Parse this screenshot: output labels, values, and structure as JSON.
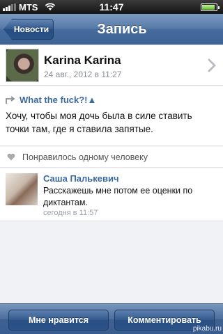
{
  "status_bar": {
    "carrier": "MTS",
    "time": "11:47"
  },
  "nav": {
    "back_label": "Новости",
    "title": "Запись"
  },
  "author": {
    "name": "Karina Karina",
    "date": "24 авг., 2012 в 11:27"
  },
  "post": {
    "repost_title": "What the fuck?!▲",
    "text": "Хочу, чтобы моя дочь была в силе ставить точки там, где я ставила запятые."
  },
  "likes": {
    "text": "Понравилось одному человеку"
  },
  "comment": {
    "author": "Саша Палькевич",
    "text": "Расскажешь мне потом ее оценки по диктантам.",
    "time": "сегодня в 11:57"
  },
  "toolbar": {
    "like_label": "Мне нравится",
    "comment_label": "Комментировать"
  },
  "watermark": "pikabu.ru",
  "colors": {
    "accent_link": "#3b6aa0",
    "navbar": "#466c9e"
  }
}
